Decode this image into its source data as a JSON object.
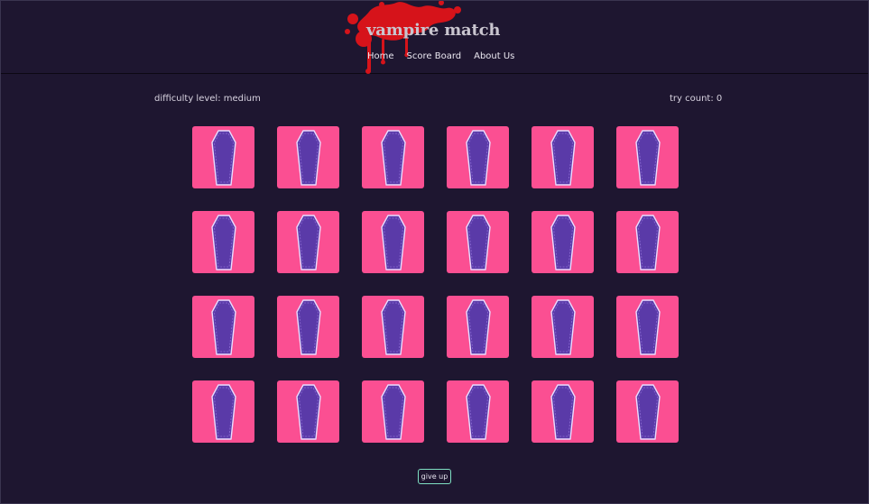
{
  "header": {
    "title": "vampire match",
    "nav": [
      {
        "label": "Home"
      },
      {
        "label": "Score Board"
      },
      {
        "label": "About Us"
      }
    ]
  },
  "status": {
    "difficulty": "difficulty level: medium",
    "try_count": "try count: 0"
  },
  "board": {
    "rows": 4,
    "columns": 6,
    "card_face": "coffin-icon",
    "card_count": 24
  },
  "actions": {
    "give_up_label": "give up"
  },
  "colors": {
    "background": "#1e1630",
    "card": "#fb4f92",
    "coffin": "#5a3aa8",
    "splat": "#d6131a",
    "button_border": "#7fe0c3"
  }
}
